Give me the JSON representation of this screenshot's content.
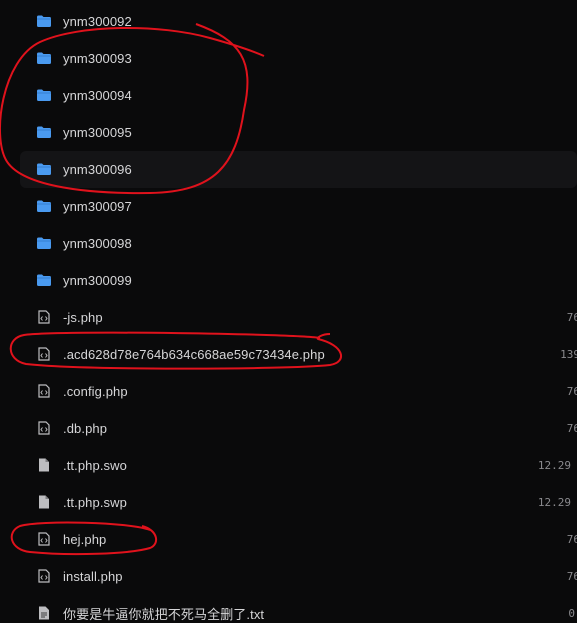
{
  "files": [
    {
      "name": "ynm300092",
      "type": "folder",
      "meta": ""
    },
    {
      "name": "ynm300093",
      "type": "folder",
      "meta": ""
    },
    {
      "name": "ynm300094",
      "type": "folder",
      "meta": ""
    },
    {
      "name": "ynm300095",
      "type": "folder",
      "meta": ""
    },
    {
      "name": "ynm300096",
      "type": "folder",
      "meta": ""
    },
    {
      "name": "ynm300097",
      "type": "folder",
      "meta": ""
    },
    {
      "name": "ynm300098",
      "type": "folder",
      "meta": ""
    },
    {
      "name": "ynm300099",
      "type": "folder",
      "meta": ""
    },
    {
      "name": "-js.php",
      "type": "code-file",
      "meta": "76"
    },
    {
      "name": ".acd628d78e764b634c668ae59c73434e.php",
      "type": "code-file",
      "meta": "139"
    },
    {
      "name": ".config.php",
      "type": "code-file",
      "meta": "76"
    },
    {
      "name": ".db.php",
      "type": "code-file",
      "meta": "76"
    },
    {
      "name": ".tt.php.swo",
      "type": "text-file",
      "meta": "12.29"
    },
    {
      "name": ".tt.php.swp",
      "type": "text-file",
      "meta": "12.29"
    },
    {
      "name": "hej.php",
      "type": "code-file",
      "meta": "76"
    },
    {
      "name": "install.php",
      "type": "code-file",
      "meta": "76"
    },
    {
      "name": "你要是牛逼你就把不死马全删了.txt",
      "type": "doc-file",
      "meta": "0"
    }
  ],
  "colors": {
    "background": "#0a0a0b",
    "hover_row": "#141416",
    "folder": "#4a9af0",
    "text": "#d6d6d8",
    "meta": "#8a8a8e",
    "annotation": "#e0121c"
  },
  "icons": {
    "folder": "folder-icon",
    "code-file": "code-file-icon",
    "text-file": "text-file-icon",
    "doc-file": "document-icon"
  }
}
